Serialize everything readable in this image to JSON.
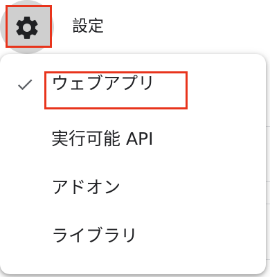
{
  "header": {
    "settings_label": "設定",
    "gear_icon": "gear-icon"
  },
  "menu": {
    "items": [
      {
        "label": "ウェブアプリ",
        "checked": true
      },
      {
        "label": "実行可能 API",
        "checked": false
      },
      {
        "label": "アドオン",
        "checked": false
      },
      {
        "label": "ライブラリ",
        "checked": false
      }
    ]
  },
  "colors": {
    "highlight": "#e8341c",
    "check": "#5f6368"
  }
}
